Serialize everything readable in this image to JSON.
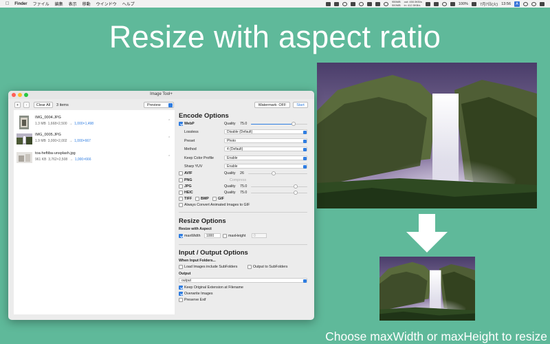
{
  "menubar": {
    "app": "Finder",
    "menus": [
      "ファイル",
      "編集",
      "表示",
      "移動",
      "ウインドウ",
      "ヘルプ"
    ],
    "stats": [
      "955MB",
      "500MB",
      "out: 450.5KB/s",
      "in: 412.5KB/s"
    ],
    "battery": "100%",
    "date": "7月7日(火)",
    "time": "13:56",
    "input_mode": "A"
  },
  "headline": "Resize with aspect ratio",
  "caption": "Choose maxWidth or maxHeight to resize",
  "window": {
    "title": "Image Tool+",
    "toolbar": {
      "plus": "+",
      "minus": "-",
      "clear_all": "Clear All",
      "count": "3 items",
      "preview": "Preview",
      "watermark": "Watermark: OFF",
      "start": "Start"
    },
    "files": [
      {
        "name": "IMG_0004.JPG",
        "size": "1.3 MB",
        "dims": "1,668×2,500",
        "arrow": "→",
        "target": "1,000×1,498"
      },
      {
        "name": "IMG_0005.JPG",
        "size": "1.9 MB",
        "dims": "3,000×2,002",
        "arrow": "→",
        "target": "1,000×667"
      },
      {
        "name": "toa-heftiba-unsplash.jpg",
        "size": "961 KB",
        "dims": "3,762×2,508",
        "arrow": "→",
        "target": "1,000×666"
      }
    ],
    "encode": {
      "heading": "Encode Options",
      "webp": "WebP",
      "quality_label": "Quality",
      "webp_quality": "75.0",
      "webp_quality_fraction": 0.75,
      "lossless_label": "Lossless",
      "lossless_value": "Disable (Default)",
      "preset_label": "Preset",
      "preset_value": "Photo",
      "method_label": "Method",
      "method_value": "4 (Default)",
      "color_profile_label": "Keep Color Profile",
      "color_profile_value": "Enable",
      "sharp_yuv_label": "Sharp YUV",
      "sharp_yuv_value": "Enable",
      "avif": "AVIF",
      "avif_quality": "26",
      "png": "PNG",
      "compress": "Compress",
      "jpg": "JPG",
      "jpg_quality": "75.0",
      "heic": "HEIC",
      "heic_quality": "75.0",
      "tiff": "TIFF",
      "bmp": "BMP",
      "gif": "GIF",
      "animated": "Always Convert Animated Images to GIF"
    },
    "resize": {
      "heading": "Resize Options",
      "subheading": "Resize with Aspect",
      "max_width_label": "maxWidth",
      "max_width_value": "1000",
      "max_height_label": "maxHeight",
      "max_height_value": "0"
    },
    "io": {
      "heading": "Input / Output Options",
      "when_input": "When Input Folders...",
      "load_subfolders": "Load Images include SubFolders",
      "output_subfolders": "Output to SubFolders",
      "output_label": "Output",
      "output_value": "output",
      "keep_ext": "Keep Original Extension at Filename",
      "overwrite": "Overwrite Images",
      "preserve_exif": "Preserve Exif"
    }
  },
  "colors": {
    "background": "#5fb99a",
    "accent": "#2f7de1"
  }
}
